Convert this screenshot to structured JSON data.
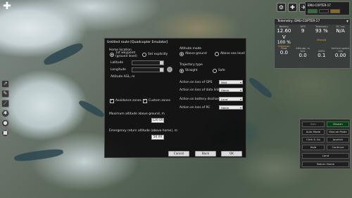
{
  "toolbar": {
    "back_glyph": "✚",
    "tools": [
      "route-icon",
      "pencil-icon",
      "ruler-icon",
      "gear-icon",
      "record-icon",
      "stop-icon"
    ]
  },
  "vehicle": {
    "name": "EMU-COPTER-17"
  },
  "telemetry": {
    "title": "Telemetry: EMU-COPTER-17",
    "cols": [
      {
        "label": "Battery",
        "value": "12.60 V",
        "sub": "100 %",
        "sub2": "Unknown"
      },
      {
        "label": "GPS",
        "value": "9",
        "sub": "",
        "sub2": ""
      },
      {
        "label": "Telemetry",
        "value": "93 %",
        "sub": "",
        "sub2": "Manual"
      },
      {
        "label": "RC rssi",
        "value": "N/A",
        "sub": "",
        "sub2": ""
      }
    ],
    "cols2": [
      {
        "label": "Flow",
        "value": "0.0"
      },
      {
        "label": "Altitude, m",
        "value": "0.0",
        "sub_label": "AGL"
      },
      {
        "label": "",
        "value": "0.1",
        "sub_label": "AMSL"
      },
      {
        "label": "Vertical speed, m/s",
        "value": "0.00"
      }
    ]
  },
  "dialog": {
    "title": "Untitled route [Quadcopter Emulator]",
    "home_location_label": "Home location",
    "home_1st_waypoint": "1st waypoint (ground level)",
    "home_set_explicitly": "Set explicitly",
    "latitude_label": "Latitude",
    "longitude_label": "Longitude",
    "altitude_agl_label": "Altitude AGL, m",
    "avoidance_zones": "Avoidance zones",
    "custom_zones": "Custom zones",
    "max_alt_label": "Maximum altitude above ground, m",
    "max_alt_value": "120.00",
    "emergency_alt_label": "Emergency return altitude (above home), m",
    "emergency_alt_value": "50.00",
    "altitude_mode_label": "Altitude mode",
    "above_ground": "Above ground",
    "above_sea_level": "Above sea level",
    "trajectory_label": "Trajectory type",
    "straight": "Straight",
    "safe": "Safe",
    "actions": [
      {
        "label": "Action on loss of GPS",
        "value": "Wait"
      },
      {
        "label": "Action on loss of data link",
        "value": "Home"
      },
      {
        "label": "Action on battery discharge",
        "value": "Land"
      },
      {
        "label": "Action on loss of RC",
        "value": "Home"
      }
    ],
    "cancel": "Cancel",
    "back": "Back",
    "ok": "OK"
  },
  "commands": {
    "arm": "Arm",
    "disarm": "Disarm",
    "auto_mode": "Auto Mode",
    "manual_mode": "Manual Mode",
    "click_go": "Click & Go",
    "joystick": "Joystick",
    "hold": "Hold",
    "continue": "Continue",
    "land": "Land",
    "return_home": "Return Home"
  }
}
